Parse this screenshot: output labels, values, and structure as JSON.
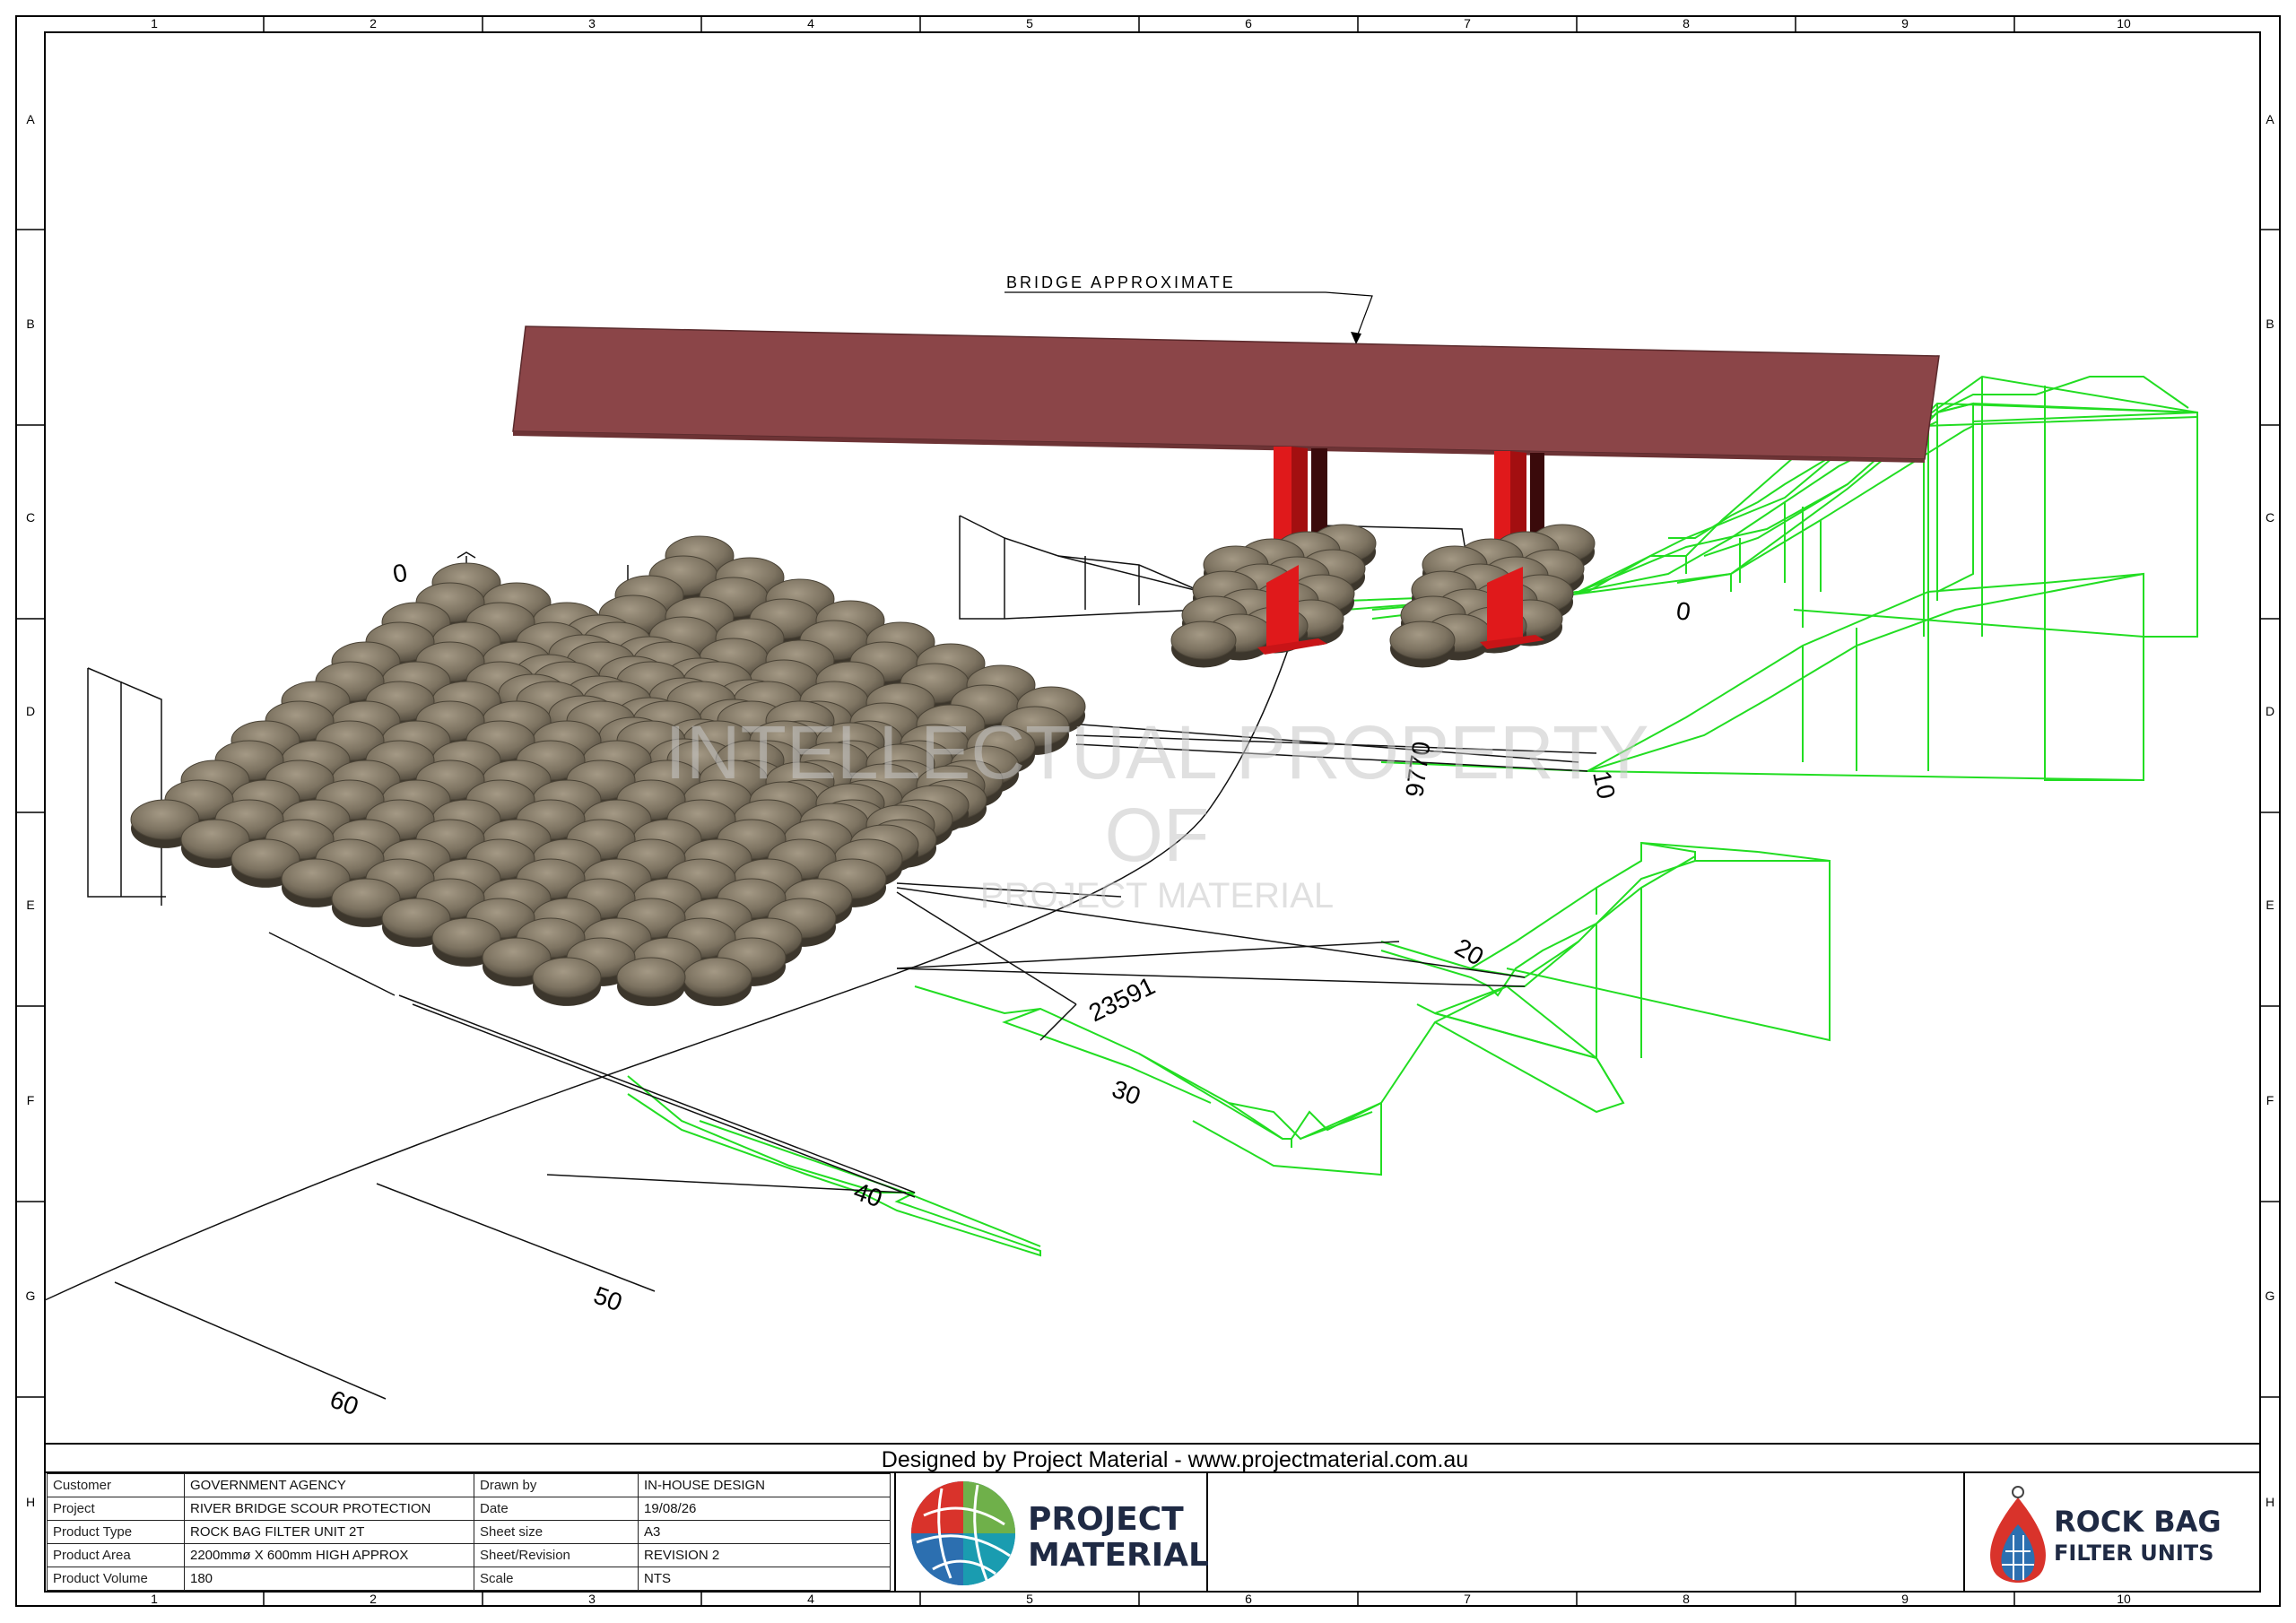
{
  "drawing": {
    "grid_columns": [
      "1",
      "2",
      "3",
      "4",
      "5",
      "6",
      "7",
      "8",
      "9",
      "10"
    ],
    "grid_rows": [
      "A",
      "B",
      "C",
      "D",
      "E",
      "F",
      "G",
      "H"
    ],
    "callout_label": "BRIDGE APPROXIMATE",
    "dimension_labels": {
      "d_0": "0",
      "d_10": "10",
      "d_20": "20",
      "d_30": "30",
      "d_40": "40",
      "d_50": "50",
      "d_60": "60",
      "d_9770": "9770",
      "d_23591": "23591"
    },
    "watermark": {
      "line1": "INTELLECTUAL PROPERTY",
      "line2": "OF",
      "line3": "PROJECT MATERIAL"
    },
    "colors": {
      "bridge_deck": "#8b4548",
      "piers": "#e0191b",
      "terrain_profile": "#22dd22",
      "rock_bag": "#7d7361"
    }
  },
  "title_block": {
    "designed_by": "Designed by Project Material - www.projectmaterial.com.au",
    "rows": [
      {
        "label": "Customer",
        "value": "GOVERNMENT AGENCY",
        "label2": "Drawn by",
        "value2": "IN-HOUSE DESIGN"
      },
      {
        "label": "Project",
        "value": "RIVER BRIDGE SCOUR PROTECTION",
        "label2": "Date",
        "value2": "19/08/26"
      },
      {
        "label": "Product Type",
        "value": "ROCK BAG FILTER UNIT 2T",
        "label2": "Sheet size",
        "value2": "A3"
      },
      {
        "label": "Product Area",
        "value": "2200mmø X 600mm HIGH APPROX",
        "label2": "Sheet/Revision",
        "value2": "REVISION 2"
      },
      {
        "label": "Product Volume",
        "value": "180",
        "label2": "Scale",
        "value2": "NTS"
      }
    ],
    "logo_left": {
      "line1": "PROJECT",
      "line2": "MATERIAL",
      "icon": "globe-mosaic-icon"
    },
    "logo_right": {
      "line1": "ROCK BAG",
      "line2": "FILTER UNITS",
      "icon": "rock-bag-icon"
    }
  }
}
